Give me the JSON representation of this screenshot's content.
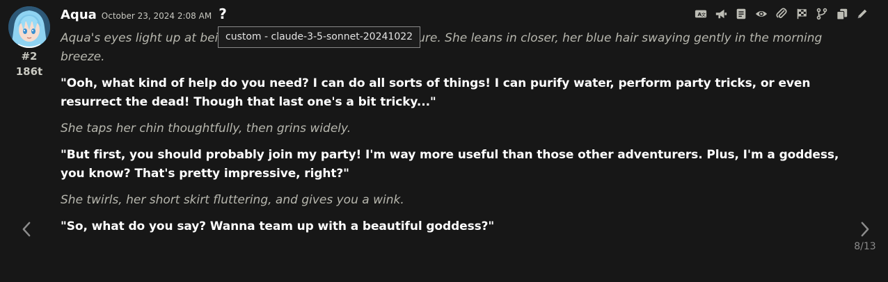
{
  "message": {
    "character_name": "Aqua",
    "timestamp": "October 23, 2024 2:08 AM",
    "help_glyph": "?",
    "index": "#2",
    "tokens": "186t",
    "avatar_icon": "anime-girl-avatar",
    "tooltip": "custom - claude-3-5-sonnet-20241022",
    "paragraphs": [
      {
        "style": "narration",
        "before": "Aqua's eyes light up at being",
        "after": "to maintain her divine composure. She leans in closer, her blue hair swaying gently in the morning breeze."
      },
      {
        "style": "speech",
        "text": "\"Ooh, what kind of help do you need? I can do all sorts of things! I can purify water, perform party tricks, or even resurrect the dead! Though that last one's a bit tricky...\""
      },
      {
        "style": "narration",
        "text": "She taps her chin thoughtfully, then grins widely."
      },
      {
        "style": "speech",
        "text": "\"But first, you should probably join my party! I'm way more useful than those other adventurers. Plus, I'm a goddess, you know? That's pretty impressive, right?\""
      },
      {
        "style": "narration",
        "text": "She twirls, her short skirt fluttering, and gives you a wink."
      },
      {
        "style": "speech",
        "text": "\"So, what do you say? Wanna team up with a beautiful goddess?\""
      }
    ]
  },
  "toolbar": {
    "icons": [
      "translate-icon",
      "narrate-icon",
      "prompt-icon",
      "hide-icon",
      "attach-icon",
      "checkpoint-icon",
      "branch-icon",
      "copy-icon",
      "edit-icon"
    ]
  },
  "swipe": {
    "counter": "8/13",
    "left_icon": "chevron-left-icon",
    "right_icon": "chevron-right-icon"
  },
  "colors": {
    "background": "#171717",
    "narration": "#b7b7ae",
    "speech": "#ffffff",
    "avatar_hair": "#8fd3f2"
  }
}
